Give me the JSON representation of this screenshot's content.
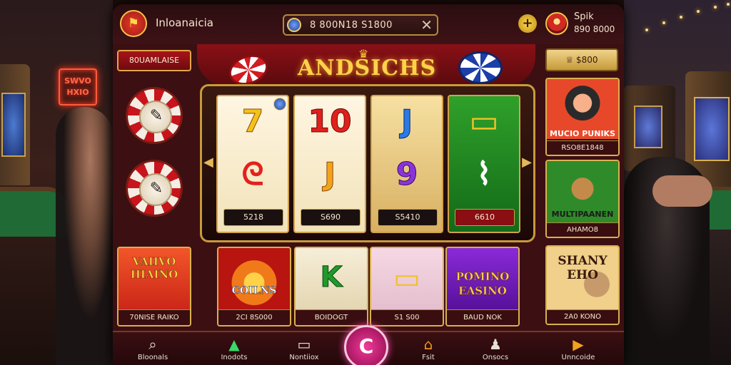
{
  "background": {
    "neon_sign": "SWVO HXIO"
  },
  "topbar": {
    "title": "Inloanaicia",
    "search_value": "8   800N18 S1800",
    "user_name": "Spik",
    "user_balance": "890 8000"
  },
  "left": {
    "pill_label": "80UAMLAISE"
  },
  "brand": {
    "title": "ANDSICHS"
  },
  "right": {
    "pill_label": "$800",
    "cards": [
      {
        "title": "MUCIO PUNIKS",
        "label": "RSO8E1848"
      },
      {
        "title": "MULTIPAANEN",
        "label": "AHAMO8"
      },
      {
        "title": "SHANY EHO",
        "label": "2A0 KONO"
      }
    ]
  },
  "reels": [
    {
      "top": "7",
      "bottom": "ᘓ",
      "value": "5218",
      "colors": [
        "#f3c21a",
        "#e2211e"
      ]
    },
    {
      "top": "10",
      "bottom": "J",
      "value": "S690",
      "colors": [
        "#e0201c",
        "#f3a41a"
      ]
    },
    {
      "top": "J",
      "bottom": "9",
      "value": "S5410",
      "colors": [
        "#2a7ae6",
        "#8a34d8"
      ]
    },
    {
      "top": "▭",
      "bottom": "⌇",
      "value": "6610",
      "colors": [
        "#f0c22a",
        "#ffffff"
      ]
    }
  ],
  "tiles": [
    {
      "title": "VAIIVO HIAINO",
      "label": "70NISE RAIKO"
    },
    {
      "title": "COILNS",
      "label": "2CI 8S000"
    },
    {
      "title": "K",
      "label": "BOIDOGT"
    },
    {
      "title": "▭",
      "label": "S1 S00"
    },
    {
      "title": "POMINO EASINO",
      "label": "BAUD NOK"
    }
  ],
  "nav": [
    {
      "icon": "⌕",
      "label": "Bloonals"
    },
    {
      "icon": "▲",
      "label": "Inodots"
    },
    {
      "icon": "▭",
      "label": "Nontiiox"
    },
    {
      "icon": "⌂",
      "label": "Fsit"
    },
    {
      "icon": "♟",
      "label": "Onsocs"
    },
    {
      "icon": "▶",
      "label": "Unncoide"
    }
  ],
  "colors": {
    "accent_gold": "#d8b050",
    "frame": "#3c0f12",
    "spin": "#f23a9a"
  }
}
